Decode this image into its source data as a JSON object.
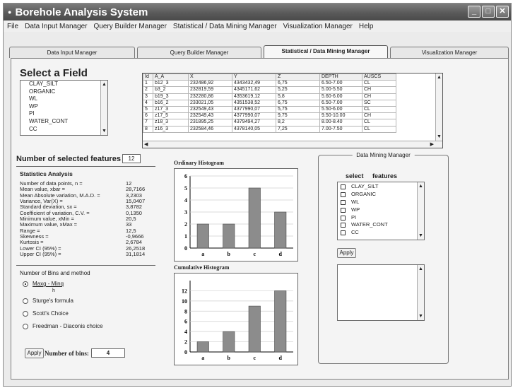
{
  "window": {
    "title": "Borehole Analysis System"
  },
  "menu": [
    "File",
    "Data Input Manager",
    "Query Builder Manager",
    "Statistical / Data Mining Manager",
    "Visualization Manager",
    "Help"
  ],
  "tabs": [
    "Data Input Manager",
    "Query Builder Manager",
    "Statistical / Data Mining Manager",
    "Visualization Manager"
  ],
  "select_field": {
    "title": "Select a Field",
    "items": [
      "CLAY_SILT",
      "ORGANIC",
      "WL",
      "WP",
      "PI",
      "WATER_CONT",
      "CC"
    ]
  },
  "table": {
    "columns": [
      "Id",
      "A_A",
      "X",
      "Y",
      "Z",
      "DEPTH",
      "AUSCS"
    ],
    "rows": [
      [
        "1",
        "b12_3",
        "232486,92",
        "4343432,49",
        "6,75",
        "6.50-7.00",
        "CL"
      ],
      [
        "2",
        "b3_2",
        "232819,59",
        "4345171,62",
        "5,25",
        "5.00-5.50",
        "CH"
      ],
      [
        "3",
        "b19_3",
        "232280,86",
        "4353619,12",
        "5,8",
        "5.60-6.00",
        "CH"
      ],
      [
        "4",
        "b16_2",
        "233021,05",
        "4351538,52",
        "6,75",
        "6.50-7.00",
        "SC"
      ],
      [
        "5",
        "z17_3",
        "232549,43",
        "4377990,07",
        "5,75",
        "5.50-6.00",
        "CL"
      ],
      [
        "6",
        "z17_5",
        "232549,43",
        "4377990,07",
        "9,75",
        "9.50-10.00",
        "CH"
      ],
      [
        "7",
        "z18_3",
        "231895,25",
        "4379494,27",
        "8,2",
        "8.00-8.40",
        "CL"
      ],
      [
        "8",
        "z16_3",
        "232584,46",
        "4378140,05",
        "7,25",
        "7.00-7.50",
        "CL"
      ]
    ]
  },
  "selected_features": {
    "label": "Number of selected features",
    "value": "12"
  },
  "statistics": {
    "title": "Statistics Analysis",
    "rows": [
      [
        "Number of data points, n =",
        "12"
      ],
      [
        "Mean value, xbar =",
        "28,7166"
      ],
      [
        "Mean Absolute variation, M.A.D. =",
        "3,2303"
      ],
      [
        "Variance, Var(X) =",
        "15,0407"
      ],
      [
        "Standard deviation, sx =",
        "3,8782"
      ],
      [
        "Coefficient of variation, C.V. =",
        "0,1350"
      ],
      [
        "Minimum value, xMin =",
        "20,5"
      ],
      [
        "Maximum value, xMax =",
        "33"
      ],
      [
        "Range =",
        "12,5"
      ],
      [
        "Skewness =",
        "-0,9666"
      ],
      [
        "Kurtosis =",
        "2,6784"
      ],
      [
        "Lower CI (95%) =",
        "26,2518"
      ],
      [
        "Upper CI (95%) =",
        "31,1814"
      ]
    ]
  },
  "bins": {
    "title": "Number of Bins and method",
    "methods": [
      "Maxg - Minq",
      "Sturge's formula",
      "Scott's Choice",
      "Freedman - Diaconis choice"
    ],
    "fraction_denominator": "h",
    "selected_index": 0,
    "apply_label": "Apply",
    "count_label": "Number of bins:",
    "count_value": "4"
  },
  "ordinary_hist": {
    "title": "Ordinary Histogram"
  },
  "cumulative_hist": {
    "title": "Cumulative Histogram"
  },
  "mining": {
    "title": "Data Mining Manager",
    "select_label": "select",
    "features_label": "features",
    "items": [
      "CLAY_SILT",
      "ORGANIC",
      "WL",
      "WP",
      "PI",
      "WATER_CONT",
      "CC"
    ],
    "apply_label": "Apply"
  },
  "chart_data": [
    {
      "type": "bar",
      "title": "Ordinary Histogram",
      "categories": [
        "a",
        "b",
        "c",
        "d"
      ],
      "values": [
        2,
        2,
        5,
        3
      ],
      "yticks": [
        0,
        1,
        2,
        3,
        4,
        5,
        6
      ],
      "ylim": [
        0,
        6
      ],
      "xlabel": "",
      "ylabel": ""
    },
    {
      "type": "bar",
      "title": "Cumulative Histogram",
      "categories": [
        "a",
        "b",
        "c",
        "d"
      ],
      "values": [
        2,
        4,
        9,
        12
      ],
      "yticks": [
        0,
        2,
        4,
        6,
        8,
        10,
        12
      ],
      "ylim": [
        0,
        14
      ],
      "xlabel": "",
      "ylabel": ""
    }
  ]
}
